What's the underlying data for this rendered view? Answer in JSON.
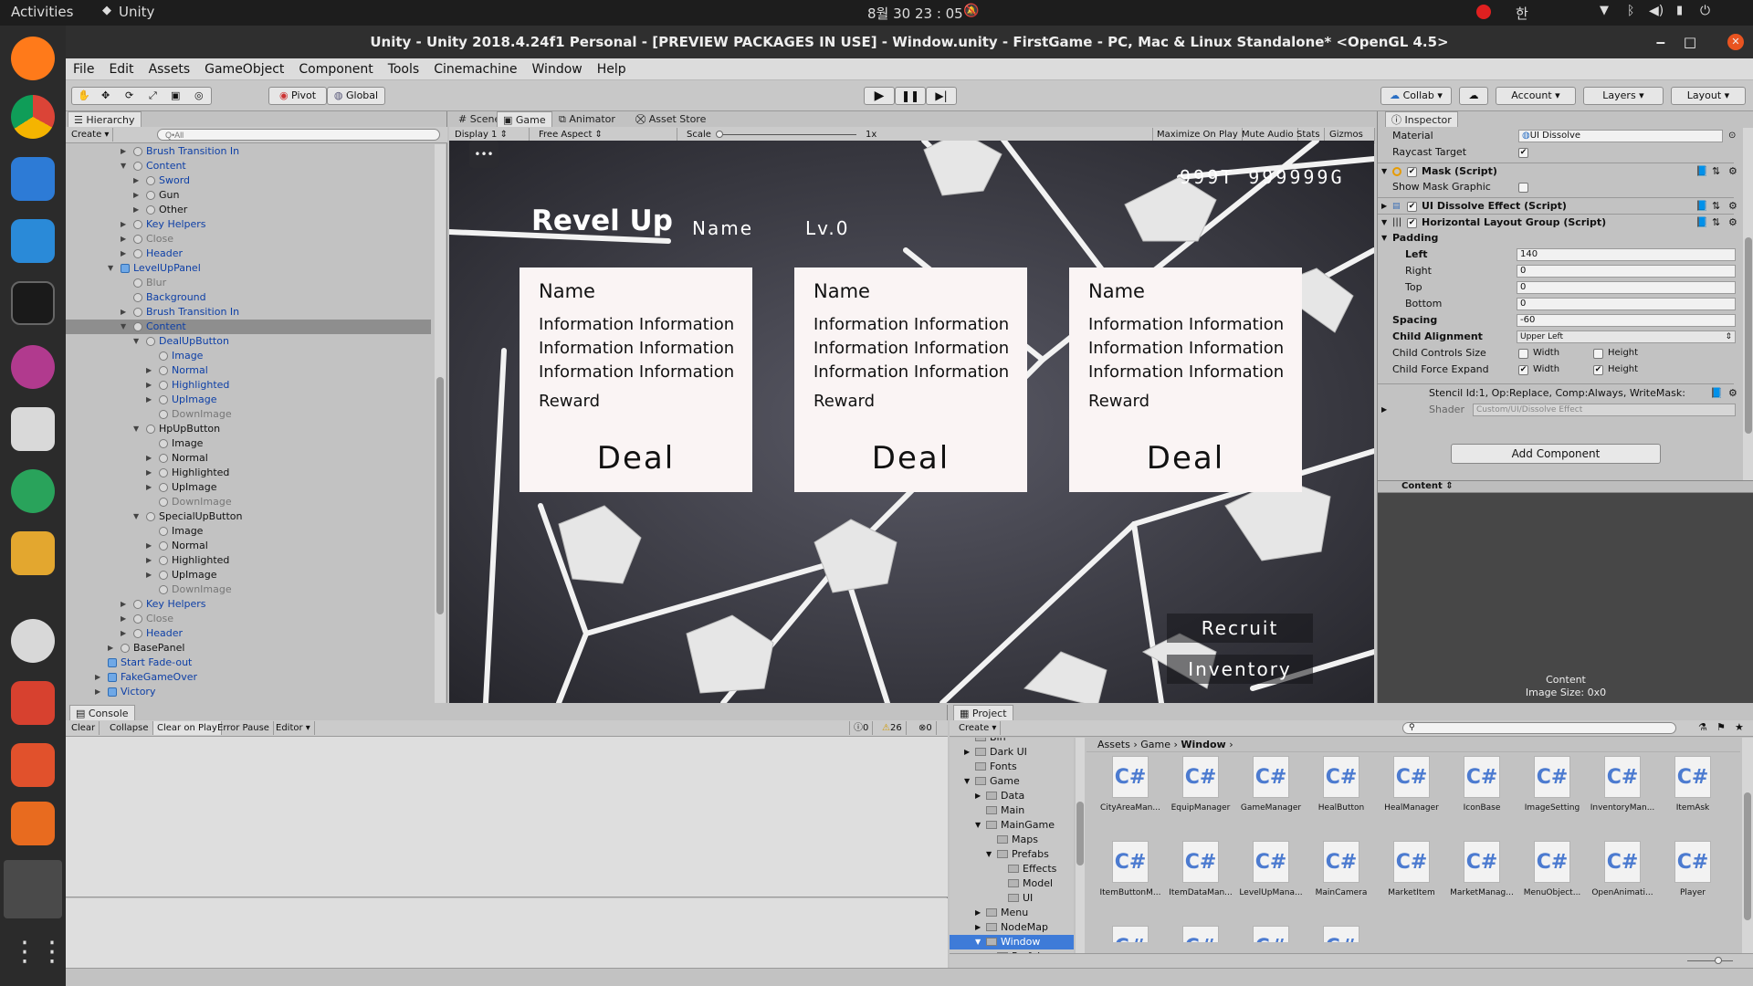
{
  "system_bar": {
    "activities": "Activities",
    "app": "Unity",
    "clock": "8월 30 23 : 05",
    "ime": "한"
  },
  "window_title": "Unity - Unity 2018.4.24f1 Personal - [PREVIEW PACKAGES IN USE] - Window.unity - FirstGame - PC, Mac & Linux Standalone* <OpenGL 4.5>",
  "menu": [
    "File",
    "Edit",
    "Assets",
    "GameObject",
    "Component",
    "Tools",
    "Cinemachine",
    "Window",
    "Help"
  ],
  "toolbar": {
    "pivot": "Pivot",
    "global": "Global",
    "collab": "Collab",
    "account": "Account",
    "layers": "Layers",
    "layout": "Layout"
  },
  "hierarchy": {
    "tab": "Hierarchy",
    "create": "Create",
    "search_placeholder": "Q•All",
    "rows": [
      {
        "label": "Brush Transition In",
        "depth": 2,
        "arrow": "right",
        "color": "blue"
      },
      {
        "label": "Content",
        "depth": 2,
        "arrow": "down",
        "color": "blue"
      },
      {
        "label": "Sword",
        "depth": 3,
        "arrow": "right",
        "color": "blue"
      },
      {
        "label": "Gun",
        "depth": 3,
        "arrow": "right",
        "color": "dark"
      },
      {
        "label": "Other",
        "depth": 3,
        "arrow": "right",
        "color": "dark"
      },
      {
        "label": "Key Helpers",
        "depth": 2,
        "arrow": "right",
        "color": "blue"
      },
      {
        "label": "Close",
        "depth": 2,
        "arrow": "right",
        "color": "gray"
      },
      {
        "label": "Header",
        "depth": 2,
        "arrow": "right",
        "color": "blue"
      },
      {
        "label": "LevelUpPanel",
        "depth": 1,
        "arrow": "down",
        "color": "blue",
        "prefab": true
      },
      {
        "label": "Blur",
        "depth": 2,
        "arrow": "",
        "color": "gray"
      },
      {
        "label": "Background",
        "depth": 2,
        "arrow": "",
        "color": "blue"
      },
      {
        "label": "Brush Transition In",
        "depth": 2,
        "arrow": "right",
        "color": "blue"
      },
      {
        "label": "Content",
        "depth": 2,
        "arrow": "down",
        "color": "blue",
        "selected": true
      },
      {
        "label": "DealUpButton",
        "depth": 3,
        "arrow": "down",
        "color": "blue"
      },
      {
        "label": "Image",
        "depth": 4,
        "arrow": "",
        "color": "blue"
      },
      {
        "label": "Normal",
        "depth": 4,
        "arrow": "right",
        "color": "blue"
      },
      {
        "label": "Highlighted",
        "depth": 4,
        "arrow": "right",
        "color": "blue"
      },
      {
        "label": "UpImage",
        "depth": 4,
        "arrow": "right",
        "color": "blue"
      },
      {
        "label": "DownImage",
        "depth": 4,
        "arrow": "",
        "color": "gray"
      },
      {
        "label": "HpUpButton",
        "depth": 3,
        "arrow": "down",
        "color": "dark"
      },
      {
        "label": "Image",
        "depth": 4,
        "arrow": "",
        "color": "dark"
      },
      {
        "label": "Normal",
        "depth": 4,
        "arrow": "right",
        "color": "dark"
      },
      {
        "label": "Highlighted",
        "depth": 4,
        "arrow": "right",
        "color": "dark"
      },
      {
        "label": "UpImage",
        "depth": 4,
        "arrow": "right",
        "color": "dark"
      },
      {
        "label": "DownImage",
        "depth": 4,
        "arrow": "",
        "color": "gray"
      },
      {
        "label": "SpecialUpButton",
        "depth": 3,
        "arrow": "down",
        "color": "dark"
      },
      {
        "label": "Image",
        "depth": 4,
        "arrow": "",
        "color": "dark"
      },
      {
        "label": "Normal",
        "depth": 4,
        "arrow": "right",
        "color": "dark"
      },
      {
        "label": "Highlighted",
        "depth": 4,
        "arrow": "right",
        "color": "dark"
      },
      {
        "label": "UpImage",
        "depth": 4,
        "arrow": "right",
        "color": "dark"
      },
      {
        "label": "DownImage",
        "depth": 4,
        "arrow": "",
        "color": "gray"
      },
      {
        "label": "Key Helpers",
        "depth": 2,
        "arrow": "right",
        "color": "blue"
      },
      {
        "label": "Close",
        "depth": 2,
        "arrow": "right",
        "color": "gray"
      },
      {
        "label": "Header",
        "depth": 2,
        "arrow": "right",
        "color": "blue"
      },
      {
        "label": "BasePanel",
        "depth": 1,
        "arrow": "right",
        "color": "dark"
      },
      {
        "label": "Start Fade-out",
        "depth": 0,
        "arrow": "",
        "color": "blue",
        "prefab": true
      },
      {
        "label": "FakeGameOver",
        "depth": 0,
        "arrow": "right",
        "color": "blue",
        "prefab": true
      },
      {
        "label": "Victory",
        "depth": 0,
        "arrow": "right",
        "color": "blue",
        "prefab": true
      }
    ]
  },
  "scene_tabs": [
    "Scene",
    "Game",
    "Animator",
    "Asset Store"
  ],
  "game_bar": {
    "display": "Display 1",
    "aspect": "Free Aspect",
    "scale_label": "Scale",
    "scale_value": "1x",
    "maximize": "Maximize On Play",
    "mute": "Mute Audio",
    "stats": "Stats",
    "gizmos": "Gizmos"
  },
  "game": {
    "menu_dots": "•••",
    "currency": "999T  999999G",
    "title": "Revel Up",
    "name_label": "Name",
    "level": "Lv.0",
    "cards": [
      {
        "name": "Name",
        "info": [
          "Information Information",
          "Information Information",
          "Information Information"
        ],
        "reward": "Reward",
        "deal": "Deal"
      },
      {
        "name": "Name",
        "info": [
          "Information Information",
          "Information Information",
          "Information Information"
        ],
        "reward": "Reward",
        "deal": "Deal"
      },
      {
        "name": "Name",
        "info": [
          "Information Information",
          "Information Information",
          "Information Information"
        ],
        "reward": "Reward",
        "deal": "Deal"
      }
    ],
    "recruit": "Recruit",
    "inventory": "Inventory"
  },
  "inspector": {
    "tab": "Inspector",
    "material_label": "Material",
    "material_value": "UI Dissolve",
    "raycast_label": "Raycast Target",
    "mask_title": "Mask (Script)",
    "show_mask_graphic": "Show Mask Graphic",
    "dissolve_title": "UI Dissolve Effect (Script)",
    "hlg_title": "Horizontal Layout Group (Script)",
    "padding": "Padding",
    "left_label": "Left",
    "left_value": "140",
    "right_label": "Right",
    "right_value": "0",
    "top_label": "Top",
    "top_value": "0",
    "bottom_label": "Bottom",
    "bottom_value": "0",
    "spacing_label": "Spacing",
    "spacing_value": "-60",
    "child_alignment_label": "Child Alignment",
    "child_alignment_value": "Upper Left",
    "controls_label": "Child Controls Size",
    "expand_label": "Child Force Expand",
    "width": "Width",
    "height": "Height",
    "stencil": "Stencil Id:1, Op:Replace, Comp:Always, WriteMask:",
    "shader_label": "Shader",
    "shader_value": "Custom/UI/Dissolve Effect",
    "add_component": "Add Component",
    "preview_header": "Content",
    "preview_name": "Content",
    "preview_size": "Image Size: 0x0"
  },
  "console": {
    "tab": "Console",
    "buttons": [
      "Clear",
      "Collapse",
      "Clear on Play",
      "Error Pause",
      "Editor"
    ],
    "counts": {
      "info": "0",
      "warn": "26",
      "error": "0"
    }
  },
  "project": {
    "tab": "Project",
    "create": "Create",
    "breadcrumb": [
      "Assets",
      "Game",
      "Window"
    ],
    "tree": [
      {
        "label": "Bin",
        "depth": 1,
        "arrow": ""
      },
      {
        "label": "Dark UI",
        "depth": 1,
        "arrow": "right"
      },
      {
        "label": "Fonts",
        "depth": 1,
        "arrow": ""
      },
      {
        "label": "Game",
        "depth": 1,
        "arrow": "down"
      },
      {
        "label": "Data",
        "depth": 2,
        "arrow": "right"
      },
      {
        "label": "Main",
        "depth": 2,
        "arrow": ""
      },
      {
        "label": "MainGame",
        "depth": 2,
        "arrow": "down"
      },
      {
        "label": "Maps",
        "depth": 3,
        "arrow": ""
      },
      {
        "label": "Prefabs",
        "depth": 3,
        "arrow": "down"
      },
      {
        "label": "Effects",
        "depth": 4,
        "arrow": ""
      },
      {
        "label": "Model",
        "depth": 4,
        "arrow": ""
      },
      {
        "label": "UI",
        "depth": 4,
        "arrow": ""
      },
      {
        "label": "Menu",
        "depth": 2,
        "arrow": "right"
      },
      {
        "label": "NodeMap",
        "depth": 2,
        "arrow": "right"
      },
      {
        "label": "Window",
        "depth": 2,
        "arrow": "down",
        "selected": true
      },
      {
        "label": "Prefabs",
        "depth": 3,
        "arrow": ""
      }
    ],
    "assets": [
      "CityAreaMan...",
      "EquipManager",
      "GameManager",
      "HealButton",
      "HealManager",
      "IconBase",
      "ImageSetting",
      "InventoryMan...",
      "ItemAsk",
      "ItemButtonM...",
      "ItemDataMan...",
      "LevelUpMana...",
      "MainCamera",
      "MarketItem",
      "MarketManag...",
      "MenuObject...",
      "OpenAnimati...",
      "Player",
      "",
      "",
      "",
      ""
    ],
    "asset_icon": "C#"
  }
}
